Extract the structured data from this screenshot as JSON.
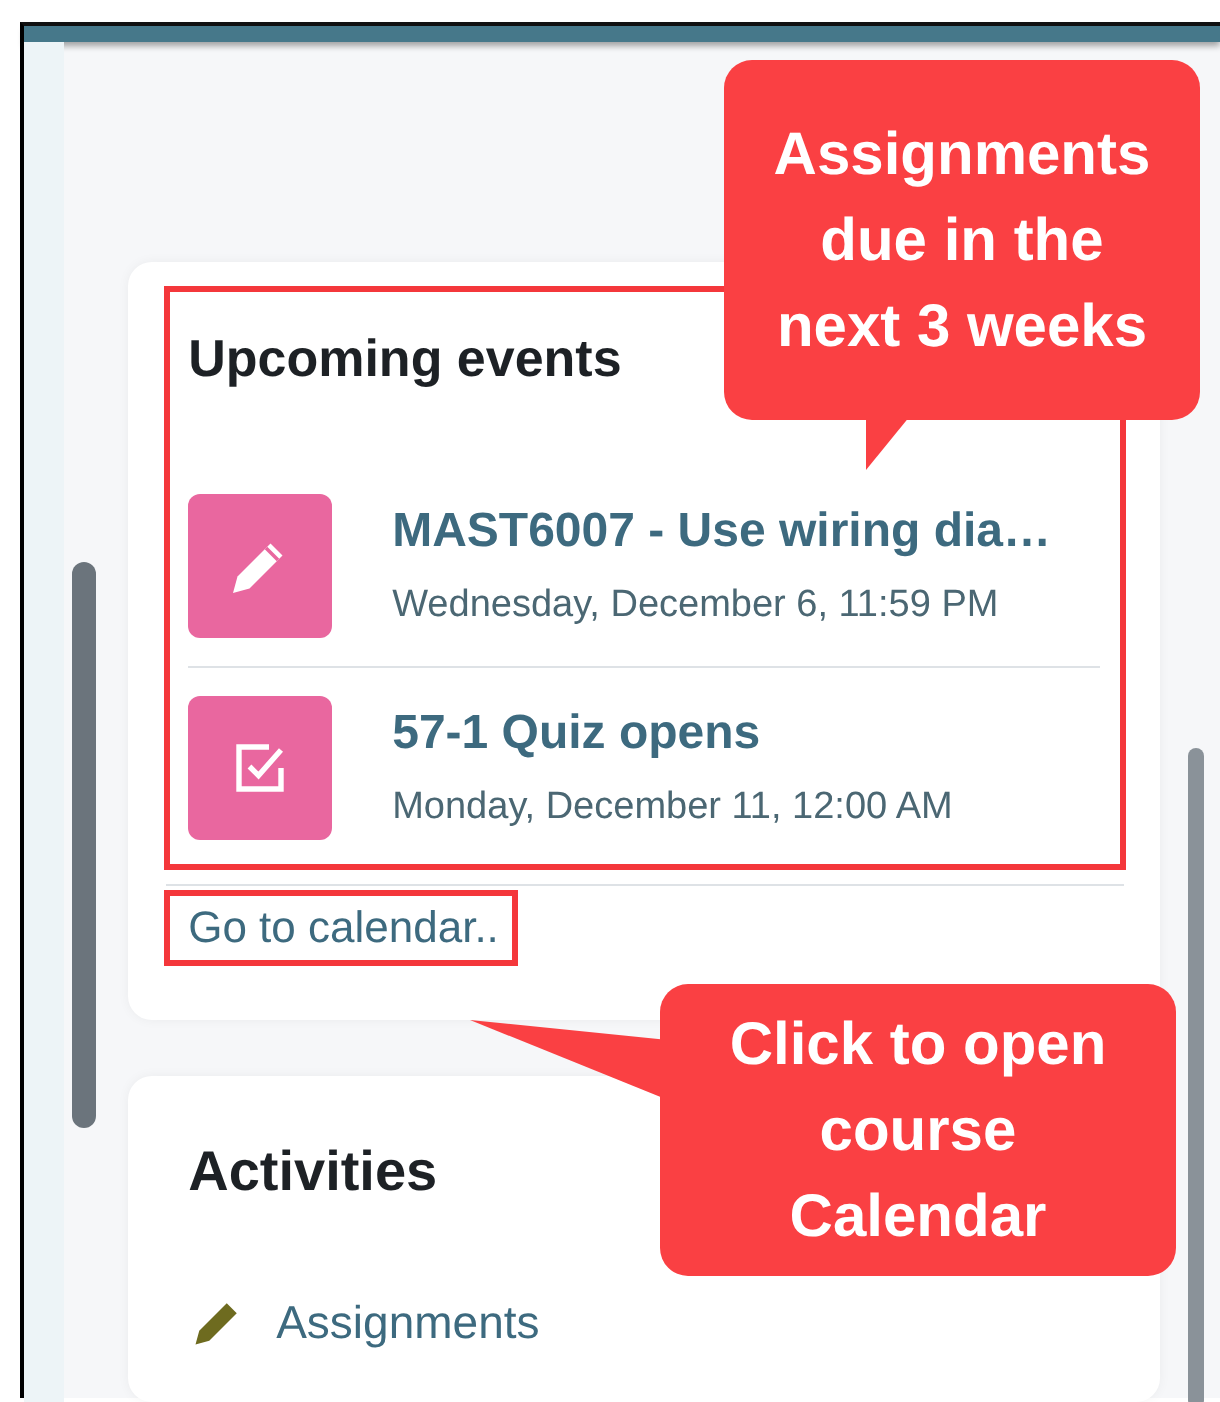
{
  "upcoming_events": {
    "title": "Upcoming events",
    "highlighted": true,
    "events": [
      {
        "kind": "assignment",
        "title": "MAST6007 - Use wiring dia…",
        "date": "Wednesday, December 6, 11:59 PM"
      },
      {
        "kind": "quiz",
        "title": "57-1 Quiz opens",
        "date": "Monday, December 11, 12:00 AM"
      }
    ],
    "calendar_link": {
      "label": "Go to calendar..",
      "highlighted": true
    }
  },
  "activities": {
    "title": "Activities",
    "items": [
      {
        "kind": "assignment",
        "label": "Assignments"
      }
    ]
  },
  "annotations": [
    {
      "text": "Assignments due in the next 3 weeks",
      "kind": "down"
    },
    {
      "text": "Click to open course Calendar",
      "kind": "left"
    }
  ]
}
